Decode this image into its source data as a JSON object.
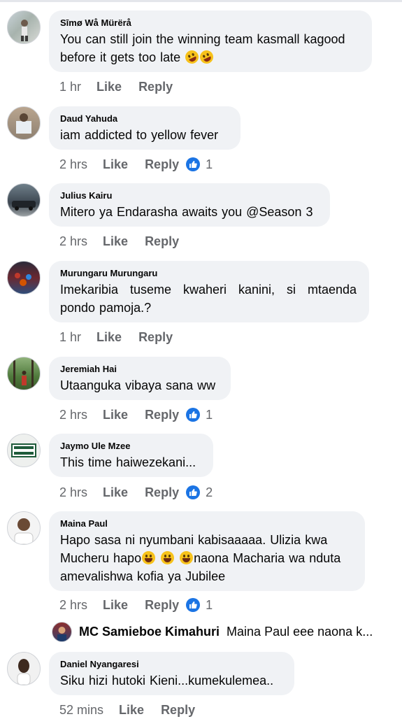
{
  "comments": [
    {
      "author": "Sīmø Wå Mürërå",
      "text_before": "You can still join the winning team kasmall kagood before it gets too late",
      "emoji": "🤣🤣",
      "time": "1 hr",
      "like": "Like",
      "reply": "Reply"
    },
    {
      "author": "Daud Yahuda",
      "text": "iam addicted to yellow fever",
      "time": "2 hrs",
      "like": "Like",
      "reply": "Reply",
      "reactions": "1"
    },
    {
      "author": "Julius Kairu",
      "text": "Mitero ya Endarasha awaits you @Season 3",
      "time": "2 hrs",
      "like": "Like",
      "reply": "Reply"
    },
    {
      "author": "Murungaru Murungaru",
      "text": "Imekaribia tuseme kwaheri kanini, si mtaenda pondo pamoja.?",
      "time": "1 hr",
      "like": "Like",
      "reply": "Reply"
    },
    {
      "author": "Jeremiah Hai",
      "text": "Utaanguka vibaya sana ww",
      "time": "2 hrs",
      "like": "Like",
      "reply": "Reply",
      "reactions": "1"
    },
    {
      "author": "Jaymo Ule Mzee",
      "text": "This time haiwezekani...",
      "time": "2 hrs",
      "like": "Like",
      "reply": "Reply",
      "reactions": "2"
    },
    {
      "author": "Maina Paul",
      "text_before": "Hapo sasa ni nyumbani kabisaaaaa. Ulizia kwa Mucheru hapo",
      "emoji": "😀😀😀",
      "text_after": "naona Macharia wa nduta amevalishwa kofia ya Jubilee",
      "time": "2 hrs",
      "like": "Like",
      "reply": "Reply",
      "reactions": "1"
    },
    {
      "author": "Daniel Nyangaresi",
      "text": "Siku hizi hutoki Kieni...kumekulemea..",
      "time": "52 mins",
      "like": "Like",
      "reply": "Reply"
    }
  ],
  "nested_reply": {
    "author": "MC Samieboe Kimahuri",
    "preview": "Maina Paul eee naona k..."
  },
  "colors": {
    "bubble": "#f0f2f5",
    "meta": "#65676b",
    "like_badge": "#1b74e4"
  },
  "icons": {
    "reaction": "thumbs-up-icon",
    "laugh": "rofl-emoji",
    "grin": "grinning-emoji"
  }
}
